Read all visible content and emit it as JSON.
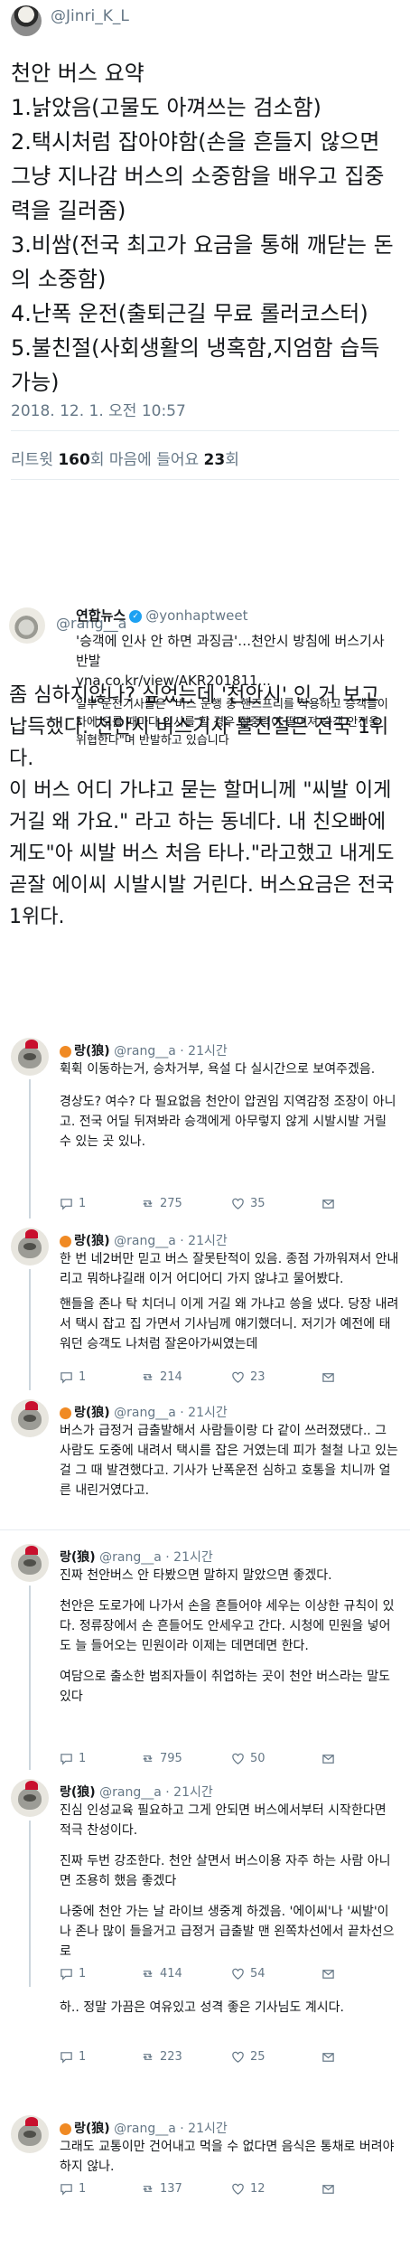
{
  "tweet": {
    "handle": "@Jinri_K_L",
    "lines": [
      "천안 버스 요약",
      "1.낡았음(고물도 아껴쓰는 검소함)",
      "2.택시처럼 잡아야함(손을 흔들지 않으면 그냥 지나감 버스의 소중함을 배우고 집중력을 길러줌)",
      "3.비쌈(전국 최고가 요금을 통해 깨닫는 돈의 소중함)",
      "4.난폭 운전(출퇴근길 무료 롤러코스터)",
      "5.불친절(사회생활의 냉혹함,지엄함 습득 가능)"
    ],
    "timestamp": "2018. 12. 1. 오전 10:57",
    "retweets_label": "리트윗",
    "retweets_count": "160",
    "retweets_unit": "회",
    "likes_label": "마음에 들어요",
    "likes_count": "23",
    "likes_unit": "회"
  },
  "quote": {
    "handle": "@rang__a",
    "lines": [
      "좀 심하지않나? 싶었는데 '천안시' 인 거 보고 납득했다. 천안시 버스기사 불친절은 전국 1위다.",
      "이 버스 어디 가냐고 묻는 할머니께 \"씨발 이게 거길 왜 가요.\" 라고 하는 동네다. 내 친오빠에게도\"아 씨발 버스 처음 타나.\"라고했고 내게도 곧잘 에이씨 시발시발 거린다. 버스요금은 전국 1위다."
    ],
    "card": {
      "source": "연합뉴스",
      "source_id": "@yonhaptweet",
      "title": "'승객에 인사 안 하면 과징금'…천안시 방침에 버스기사 반발",
      "url": "yna.co.kr/view/AKR201811...",
      "body": "일부 운전기사들은 \"버스 운행 중 핸즈프리를 착용하고 승객들이 차에 오를 때마다 인사를 할 경우 집중력이 떨어져 승객 안전을 위협한다\"며 반발하고 있습니다"
    }
  },
  "replies": [
    {
      "name": "랑(狼)",
      "handle": "@rang__a",
      "time": "· 21시간",
      "paragraphs": [
        "휙휙 이동하는거, 승차거부, 욕설 다 실시간으로 보여주겠음.",
        "경상도? 여수? 다 필요없음 천안이 압권임 지역감정 조장이 아니고. 전국 어딜 뒤져봐라 승객에게 아무렇지 않게 시발시발 거릴 수 있는 곳 있나."
      ],
      "reply_count": "1",
      "retweet_count": "275",
      "like_count": "35"
    },
    {
      "name": "랑(狼)",
      "handle": "@rang__a",
      "time": "· 21시간",
      "paragraphs": [
        "한 번 네2버만 믿고 버스 잘못탄적이 있음. 종점 가까워져서 안내리고 뭐하냐길래 이거 어디어디 가지 않냐고 물어봤다.",
        "핸들을 존나 탁 치더니 이게 거길 왜 가냐고 씅을 냈다. 당장 내려서 택시 잡고 집 가면서 기사님께 얘기했더니. 저기가 예전에 태워던 승객도 나처럼 잘온아가씨였는데"
      ],
      "reply_count": "1",
      "retweet_count": "214",
      "like_count": "23"
    },
    {
      "name": "랑(狼)",
      "handle": "@rang__a",
      "time": "· 21시간",
      "paragraphs": [
        "버스가 급정거 급출발해서 사람들이랑 다 같이 쓰러졌댔다.. 그 사람도 도중에 내려서 택시를 잡은 거였는데 피가 철철 나고 있는 걸 그 때 발견했다고. 기사가 난폭운전 심하고 호통을 치니까 얼른 내린거였다고."
      ],
      "reply_count": "",
      "retweet_count": "",
      "like_count": ""
    },
    {
      "name": "랑(狼)",
      "handle": "@rang__a",
      "time": "· 21시간",
      "paragraphs": [
        "진짜 천안버스 안 타봤으면 말하지 말았으면 좋겠다.",
        "천안은 도로가에 나가서 손을 흔들어야 세우는 이상한 규칙이 있다. 정류장에서 손 흔들어도 안세우고 간다. 시청에 민원을 넣어도 늘 들어오는 민원이라 이제는 데면데면 한다.",
        "여담으로 출소한 범죄자들이 취업하는 곳이 천안 버스라는 말도 있다"
      ],
      "reply_count": "1",
      "retweet_count": "795",
      "like_count": "50"
    },
    {
      "name": "랑(狼)",
      "handle": "@rang__a",
      "time": "· 21시간",
      "paragraphs": [
        "진심 인성교육 필요하고 그게 안되면 버스에서부터 시작한다면 적극 찬성이다.",
        "진짜 두번 강조한다. 천안 살면서 버스이용 자주 하는 사람 아니면 조용히 했음 좋겠다",
        "나중에 천안 가는 날 라이브 생중계 하겠음. '에이씨'나 '씨발'이나 존나 많이 들을거고 급정거 급출발 맨 왼쪽차선에서 끝차선으로"
      ],
      "reply_count": "1",
      "retweet_count": "414",
      "like_count": "54"
    },
    {
      "name": "",
      "handle": "",
      "time": "",
      "paragraphs": [
        "하.. 정말 가끔은 여유있고 성격 좋은 기사님도 계시다."
      ],
      "reply_count": "1",
      "retweet_count": "223",
      "like_count": "25"
    },
    {
      "name": "랑(狼)",
      "handle": "@rang__a",
      "time": "· 21시간",
      "paragraphs": [
        "그래도 교통이만 건어내고 먹을 수 없다면 음식은 통채로 버려야하지 않나."
      ],
      "reply_count": "1",
      "retweet_count": "137",
      "like_count": "12"
    }
  ]
}
